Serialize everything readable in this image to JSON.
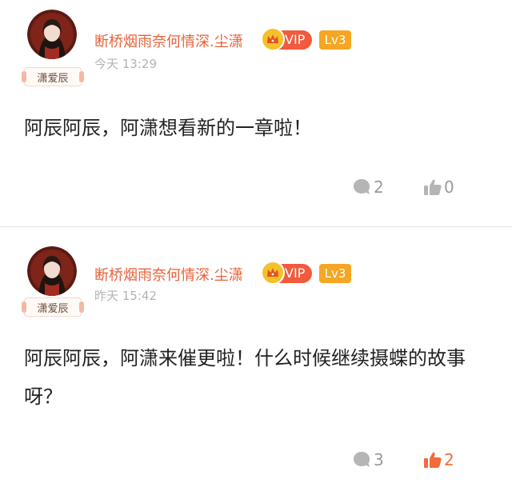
{
  "comments": [
    {
      "username": "断桥烟雨奈何情深.尘潇",
      "vip_label": "VIP",
      "level": "Lv3",
      "fan_badge": "潇爱辰",
      "time": "今天 13:29",
      "text": "阿辰阿辰，阿潇想看新的一章啦！",
      "replies": "2",
      "likes": "0",
      "liked": false
    },
    {
      "username": "断桥烟雨奈何情深.尘潇",
      "vip_label": "VIP",
      "level": "Lv3",
      "fan_badge": "潇爱辰",
      "time": "昨天 15:42",
      "text": "阿辰阿辰，阿潇来催更啦！什么时候继续摄蝶的故事呀？",
      "replies": "3",
      "likes": "2",
      "liked": true
    }
  ],
  "colors": {
    "username": "#e8623a",
    "vip": "#f15a3c",
    "crown": "#f5c12a",
    "level": "#f5a623",
    "time": "#b3b3b3",
    "icon_gray": "#9a9a9a",
    "like_active": "#f26b3a"
  },
  "icons": {
    "reply": "comment-bubble-icon",
    "like": "thumbs-up-icon",
    "vip": "crown-icon"
  }
}
